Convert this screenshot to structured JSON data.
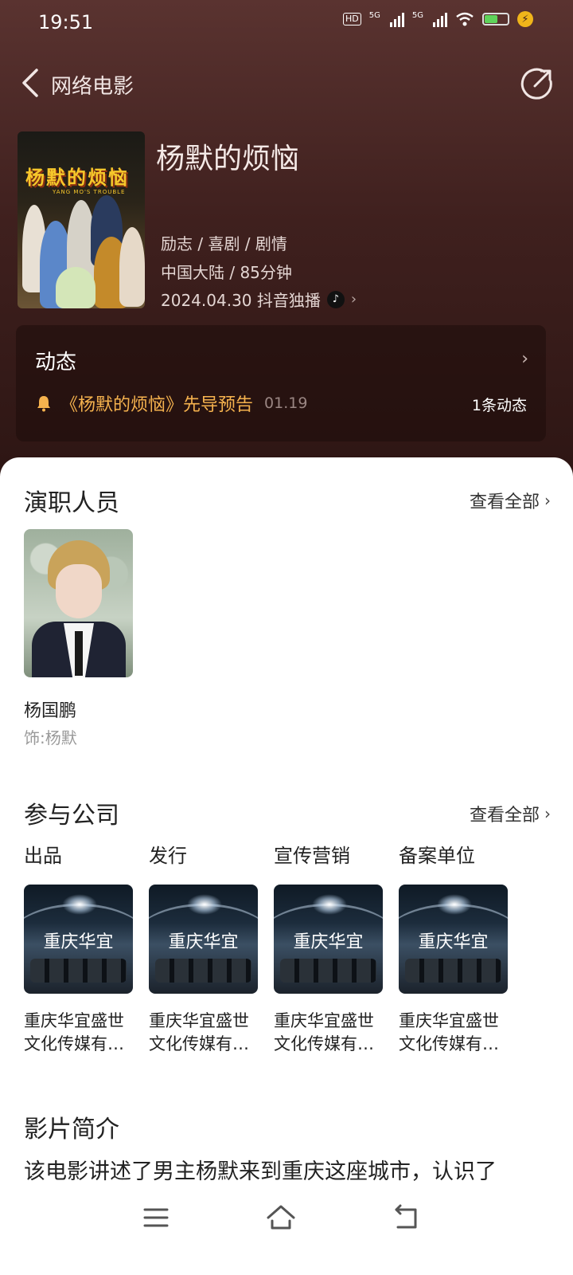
{
  "status_bar": {
    "time": "19:51",
    "net1": "5G",
    "net2": "5G",
    "hd": "HD"
  },
  "nav": {
    "title": "网络电影"
  },
  "movie": {
    "poster_title": "杨默的烦恼",
    "poster_subtitle": "YANG MO'S TROUBLE",
    "title": "杨默的烦恼",
    "genres": "励志 / 喜剧 / 剧情",
    "region_duration": "中国大陆 / 85分钟",
    "release": "2024.04.30 抖音独播"
  },
  "dynamics": {
    "title": "动态",
    "item_text": "《杨默的烦恼》先导预告",
    "item_date": "01.19",
    "count": "1条动态"
  },
  "cast_section": {
    "title": "演职人员",
    "see_all": "查看全部",
    "members": [
      {
        "name": "杨国鹏",
        "role": "饰:杨默"
      }
    ]
  },
  "company_section": {
    "title": "参与公司",
    "see_all": "查看全部",
    "companies": [
      {
        "type": "出品",
        "logo_text": "重庆华宜",
        "name": "重庆华宜盛世文化传媒有…"
      },
      {
        "type": "发行",
        "logo_text": "重庆华宜",
        "name": "重庆华宜盛世文化传媒有…"
      },
      {
        "type": "宣传营销",
        "logo_text": "重庆华宜",
        "name": "重庆华宜盛世文化传媒有…"
      },
      {
        "type": "备案单位",
        "logo_text": "重庆华宜",
        "name": "重庆华宜盛世文化传媒有…"
      }
    ]
  },
  "intro_section": {
    "title": "影片简介",
    "text": "该电影讲述了男主杨默来到重庆这座城市，认识了"
  },
  "colors": {
    "accent": "#f5b24e",
    "hero_bg": "#3f201e",
    "battery": "#5fd35a"
  }
}
